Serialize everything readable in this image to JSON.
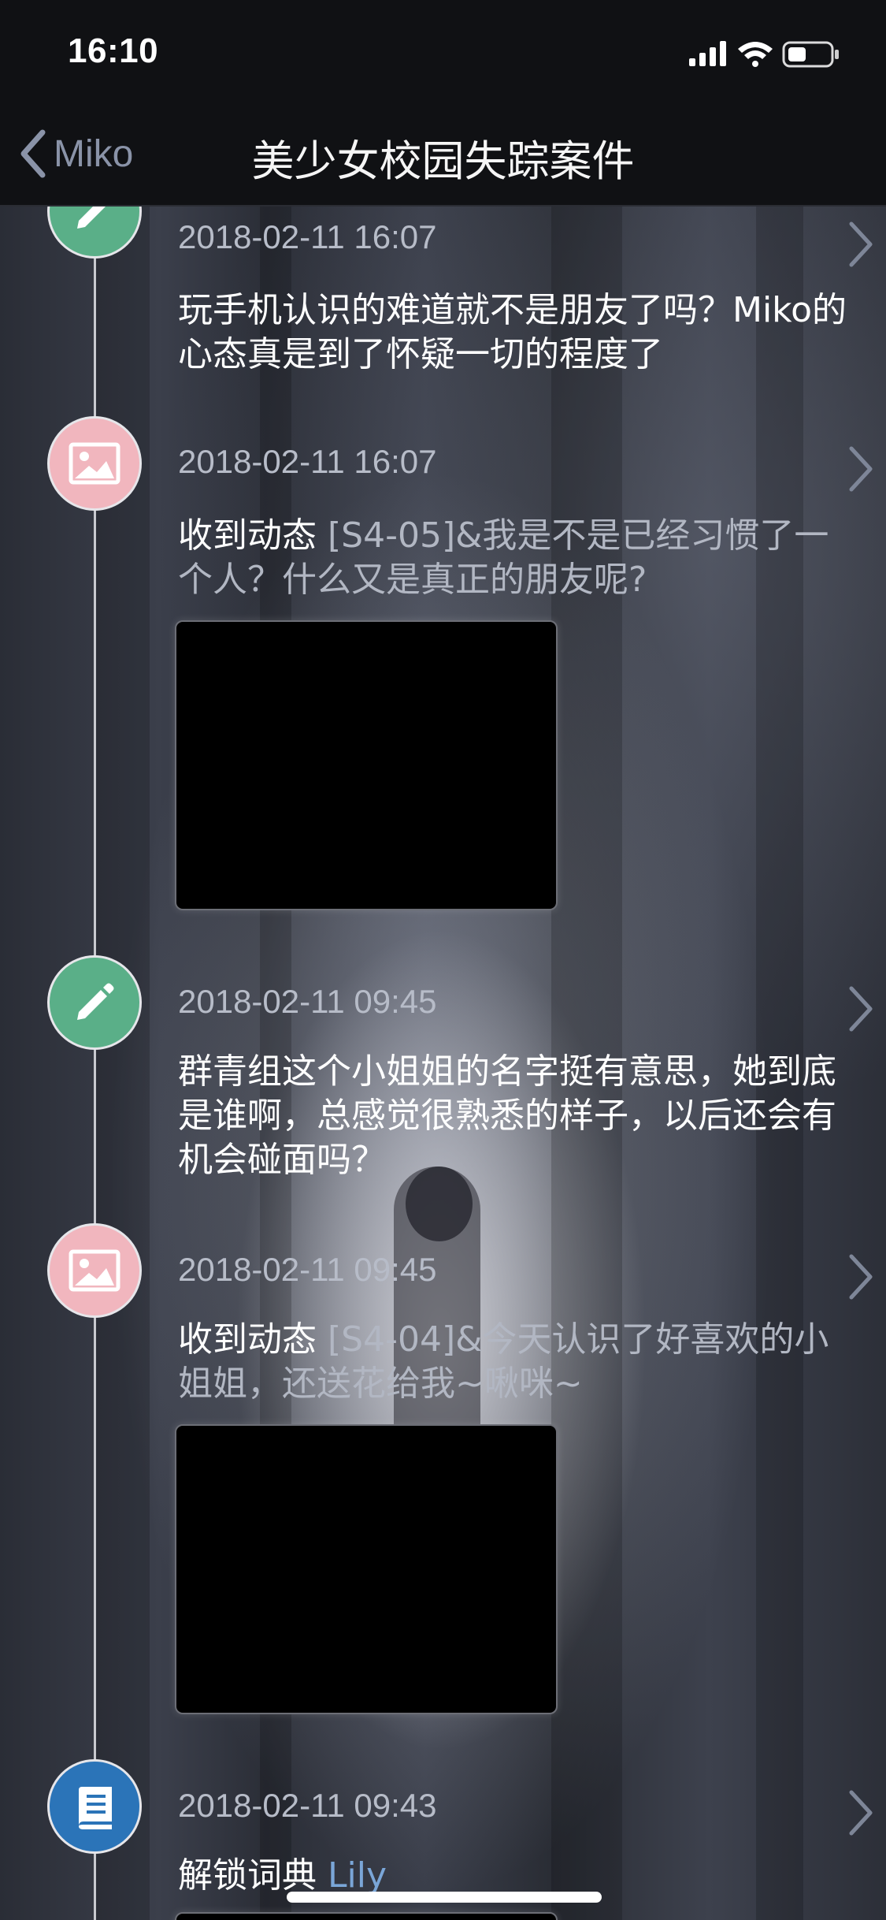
{
  "status": {
    "time": "16:10"
  },
  "nav": {
    "back_label": "Miko",
    "title": "美少女校园失踪案件"
  },
  "entries": [
    {
      "type": "note",
      "icon": "pencil-icon",
      "color": "#5aaf88",
      "timestamp": "2018-02-11 16:07",
      "text": "玩手机认识的难道就不是朋友了吗？Miko的心态真是到了怀疑一切的程度了"
    },
    {
      "type": "post",
      "icon": "image-icon",
      "color": "#f1b6be",
      "timestamp": "2018-02-11 16:07",
      "prefix": "收到动态 ",
      "tag": "[S4-05]&我是不是已经习惯了一个人？什么又是真正的朋友呢?"
    },
    {
      "type": "note",
      "icon": "pencil-icon",
      "color": "#5aaf88",
      "timestamp": "2018-02-11 09:45",
      "text": "群青组这个小姐姐的名字挺有意思，她到底是谁啊，总感觉很熟悉的样子，以后还会有机会碰面吗？"
    },
    {
      "type": "post",
      "icon": "image-icon",
      "color": "#f1b6be",
      "timestamp": "2018-02-11 09:45",
      "prefix": "收到动态 ",
      "tag": "[S4-04]&今天认识了好喜欢的小姐姐，还送花给我~啾咪~"
    },
    {
      "type": "dictionary",
      "icon": "book-icon",
      "color": "#2b74b8",
      "timestamp": "2018-02-11 09:43",
      "prefix": "解锁词典 ",
      "link": "Lily"
    }
  ]
}
